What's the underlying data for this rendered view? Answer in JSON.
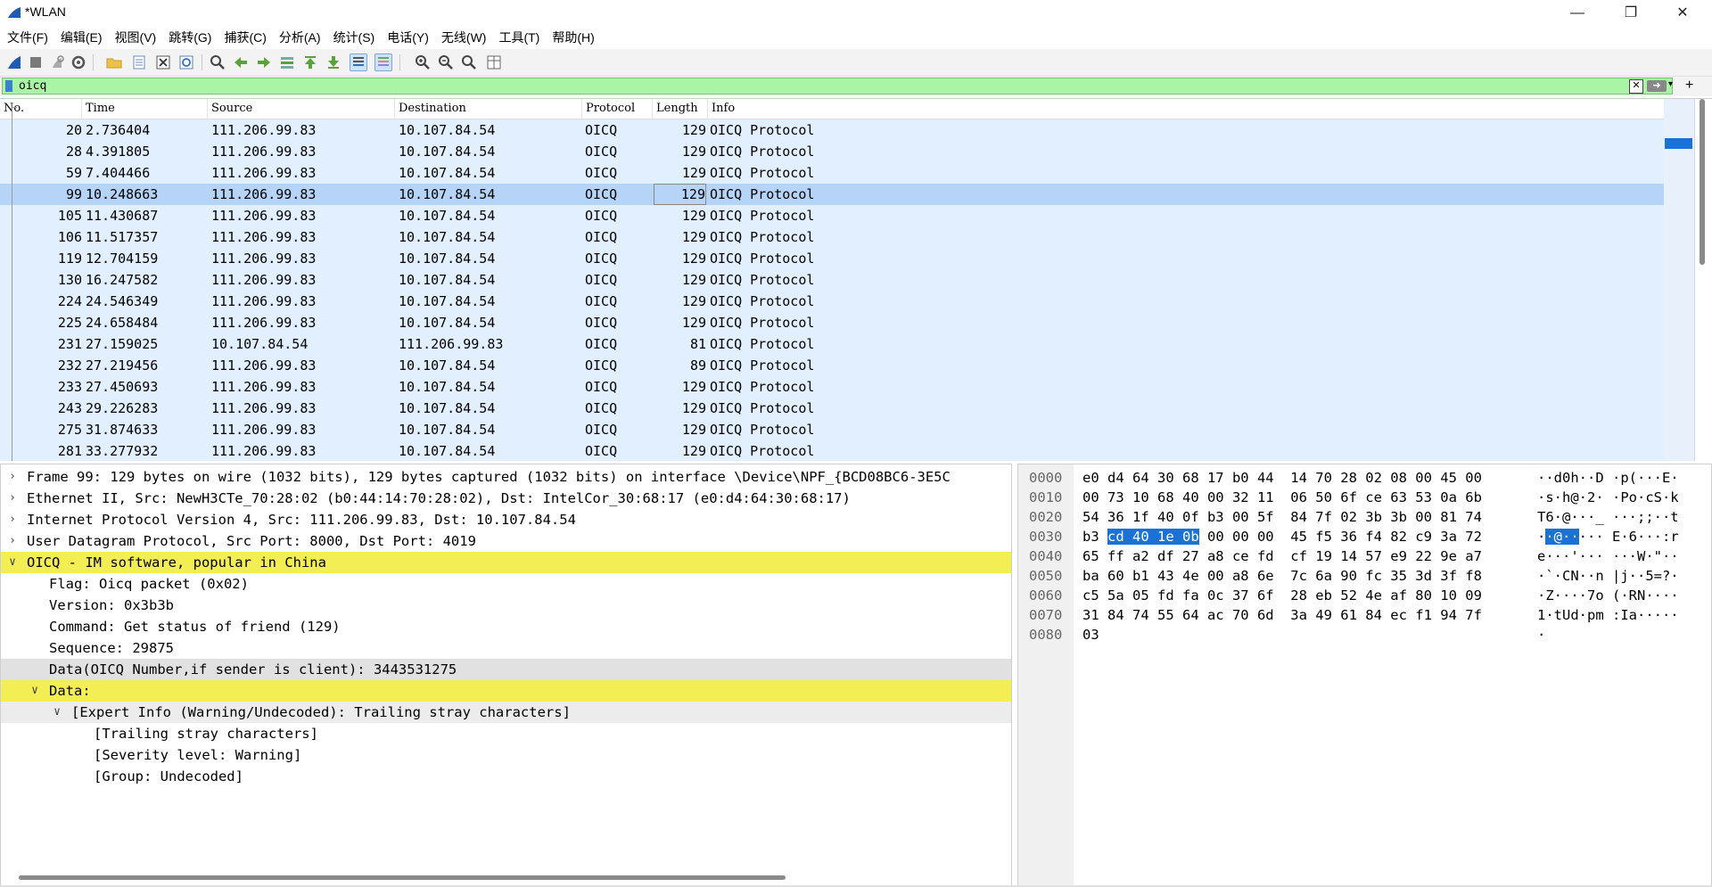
{
  "window": {
    "title": "*WLAN"
  },
  "menu": [
    "文件(F)",
    "编辑(E)",
    "视图(V)",
    "跳转(G)",
    "捕获(C)",
    "分析(A)",
    "统计(S)",
    "电话(Y)",
    "无线(W)",
    "工具(T)",
    "帮助(H)"
  ],
  "filter": {
    "value": "oicq"
  },
  "packet_list": {
    "columns": [
      "No.",
      "Time",
      "Source",
      "Destination",
      "Protocol",
      "Length",
      "Info"
    ],
    "rows": [
      {
        "no": "20",
        "time": "2.736404",
        "src": "111.206.99.83",
        "dst": "10.107.84.54",
        "proto": "OICQ",
        "len": "129",
        "info": "OICQ Protocol"
      },
      {
        "no": "28",
        "time": "4.391805",
        "src": "111.206.99.83",
        "dst": "10.107.84.54",
        "proto": "OICQ",
        "len": "129",
        "info": "OICQ Protocol"
      },
      {
        "no": "59",
        "time": "7.404466",
        "src": "111.206.99.83",
        "dst": "10.107.84.54",
        "proto": "OICQ",
        "len": "129",
        "info": "OICQ Protocol"
      },
      {
        "no": "99",
        "time": "10.248663",
        "src": "111.206.99.83",
        "dst": "10.107.84.54",
        "proto": "OICQ",
        "len": "129",
        "info": "OICQ Protocol",
        "selected": true
      },
      {
        "no": "105",
        "time": "11.430687",
        "src": "111.206.99.83",
        "dst": "10.107.84.54",
        "proto": "OICQ",
        "len": "129",
        "info": "OICQ Protocol"
      },
      {
        "no": "106",
        "time": "11.517357",
        "src": "111.206.99.83",
        "dst": "10.107.84.54",
        "proto": "OICQ",
        "len": "129",
        "info": "OICQ Protocol"
      },
      {
        "no": "119",
        "time": "12.704159",
        "src": "111.206.99.83",
        "dst": "10.107.84.54",
        "proto": "OICQ",
        "len": "129",
        "info": "OICQ Protocol"
      },
      {
        "no": "130",
        "time": "16.247582",
        "src": "111.206.99.83",
        "dst": "10.107.84.54",
        "proto": "OICQ",
        "len": "129",
        "info": "OICQ Protocol"
      },
      {
        "no": "224",
        "time": "24.546349",
        "src": "111.206.99.83",
        "dst": "10.107.84.54",
        "proto": "OICQ",
        "len": "129",
        "info": "OICQ Protocol"
      },
      {
        "no": "225",
        "time": "24.658484",
        "src": "111.206.99.83",
        "dst": "10.107.84.54",
        "proto": "OICQ",
        "len": "129",
        "info": "OICQ Protocol"
      },
      {
        "no": "231",
        "time": "27.159025",
        "src": "10.107.84.54",
        "dst": "111.206.99.83",
        "proto": "OICQ",
        "len": "81",
        "info": "OICQ Protocol"
      },
      {
        "no": "232",
        "time": "27.219456",
        "src": "111.206.99.83",
        "dst": "10.107.84.54",
        "proto": "OICQ",
        "len": "89",
        "info": "OICQ Protocol"
      },
      {
        "no": "233",
        "time": "27.450693",
        "src": "111.206.99.83",
        "dst": "10.107.84.54",
        "proto": "OICQ",
        "len": "129",
        "info": "OICQ Protocol"
      },
      {
        "no": "243",
        "time": "29.226283",
        "src": "111.206.99.83",
        "dst": "10.107.84.54",
        "proto": "OICQ",
        "len": "129",
        "info": "OICQ Protocol"
      },
      {
        "no": "275",
        "time": "31.874633",
        "src": "111.206.99.83",
        "dst": "10.107.84.54",
        "proto": "OICQ",
        "len": "129",
        "info": "OICQ Protocol"
      },
      {
        "no": "281",
        "time": "33.277932",
        "src": "111.206.99.83",
        "dst": "10.107.84.54",
        "proto": "OICQ",
        "len": "129",
        "info": "OICQ Protocol"
      }
    ]
  },
  "details": [
    {
      "text": "Frame 99: 129 bytes on wire (1032 bits), 129 bytes captured (1032 bits) on interface \\Device\\NPF_{BCD08BC6-3E5C",
      "arrow": "collapsed",
      "indent": 0
    },
    {
      "text": "Ethernet II, Src: NewH3CTe_70:28:02 (b0:44:14:70:28:02), Dst: IntelCor_30:68:17 (e0:d4:64:30:68:17)",
      "arrow": "collapsed",
      "indent": 0
    },
    {
      "text": "Internet Protocol Version 4, Src: 111.206.99.83, Dst: 10.107.84.54",
      "arrow": "collapsed",
      "indent": 0
    },
    {
      "text": "User Datagram Protocol, Src Port: 8000, Dst Port: 4019",
      "arrow": "collapsed",
      "indent": 0
    },
    {
      "text": "OICQ - IM software, popular in China",
      "arrow": "expanded",
      "indent": 0,
      "style": "hl"
    },
    {
      "text": "Flag: Oicq packet (0x02)",
      "arrow": "none",
      "indent": 1
    },
    {
      "text": "Version: 0x3b3b",
      "arrow": "none",
      "indent": 1
    },
    {
      "text": "Command: Get status of friend (129)",
      "arrow": "none",
      "indent": 1
    },
    {
      "text": "Sequence: 29875",
      "arrow": "none",
      "indent": 1
    },
    {
      "text": "Data(OICQ Number,if sender is client): 3443531275",
      "arrow": "none",
      "indent": 1,
      "style": "gray"
    },
    {
      "text": "Data:",
      "arrow": "expanded",
      "indent": 1,
      "style": "hl"
    },
    {
      "text": "[Expert Info (Warning/Undecoded): Trailing stray characters]",
      "arrow": "expanded",
      "indent": 2,
      "style": "gray2"
    },
    {
      "text": "[Trailing stray characters]",
      "arrow": "none",
      "indent": 3
    },
    {
      "text": "[Severity level: Warning]",
      "arrow": "none",
      "indent": 3
    },
    {
      "text": "[Group: Undecoded]",
      "arrow": "none",
      "indent": 3
    }
  ],
  "bytes": [
    {
      "off": "0000",
      "hex": "e0 d4 64 30 68 17 b0 44  14 70 28 02 08 00 45 00",
      "asc": "··d0h··D ·p(···E·"
    },
    {
      "off": "0010",
      "hex": "00 73 10 68 40 00 32 11  06 50 6f ce 63 53 0a 6b",
      "asc": "·s·h@·2· ·Po·cS·k"
    },
    {
      "off": "0020",
      "hex": "54 36 1f 40 0f b3 00 5f  84 7f 02 3b 3b 00 81 74",
      "asc": "T6·@···_ ···;;··t"
    },
    {
      "off": "0030",
      "hex_pre": "b3 ",
      "hex_sel": "cd 40 1e 0b",
      "hex_post": " 00 00 00  45 f5 36 f4 82 c9 3a 72",
      "asc_pre": "·",
      "asc_sel": "·@··",
      "asc_post": "··· E·6···:r"
    },
    {
      "off": "0040",
      "hex": "65 ff a2 df 27 a8 ce fd  cf 19 14 57 e9 22 9e a7",
      "asc": "e···'··· ···W·\"··"
    },
    {
      "off": "0050",
      "hex": "ba 60 b1 43 4e 00 a8 6e  7c 6a 90 fc 35 3d 3f f8",
      "asc": "·`·CN··n |j··5=?·"
    },
    {
      "off": "0060",
      "hex": "c5 5a 05 fd fa 0c 37 6f  28 eb 52 4e af 80 10 09",
      "asc": "·Z····7o (·RN····"
    },
    {
      "off": "0070",
      "hex": "31 84 74 55 64 ac 70 6d  3a 49 61 84 ec f1 94 7f",
      "asc": "1·tUd·pm :Ia·····"
    },
    {
      "off": "0080",
      "hex": "03",
      "asc": "·"
    }
  ]
}
